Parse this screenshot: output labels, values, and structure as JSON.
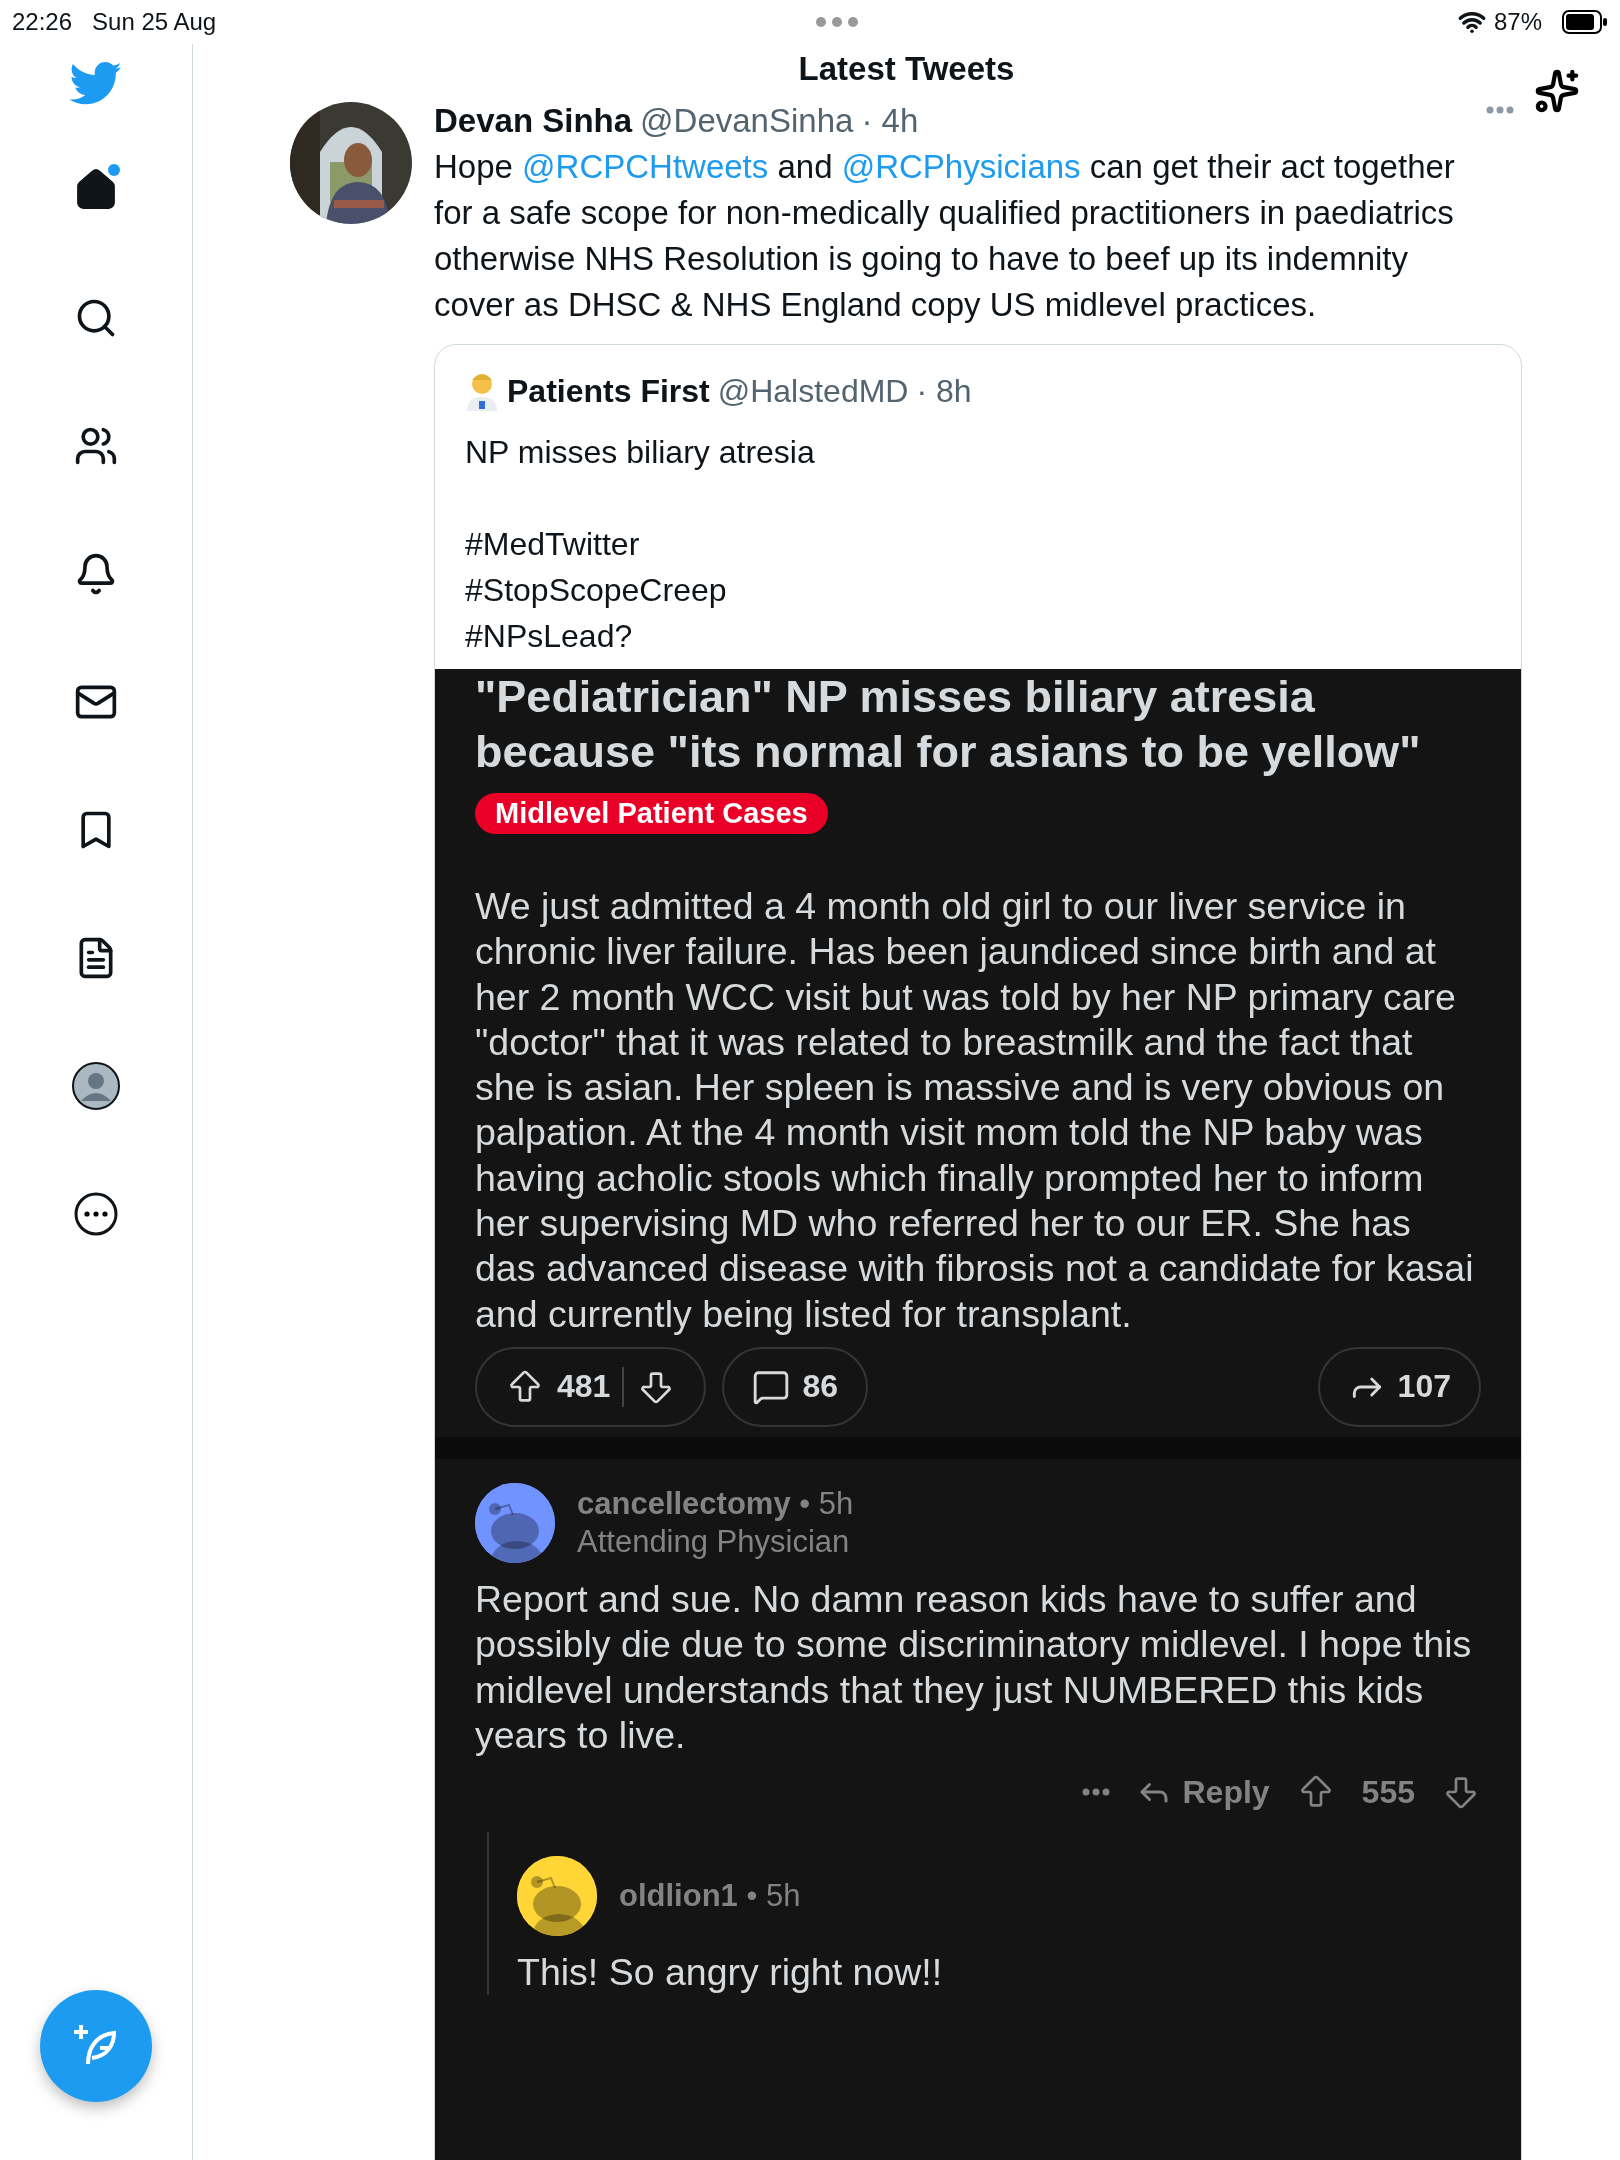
{
  "status_bar": {
    "time": "22:26",
    "date": "Sun 25 Aug",
    "battery": "87%"
  },
  "sidebar": {
    "items": [
      {
        "kind": "home",
        "selected": true,
        "unread": true
      },
      {
        "kind": "search",
        "selected": false,
        "unread": false
      },
      {
        "kind": "people",
        "selected": false,
        "unread": false
      },
      {
        "kind": "notifications",
        "selected": false,
        "unread": false
      },
      {
        "kind": "messages",
        "selected": false,
        "unread": false
      },
      {
        "kind": "bookmarks",
        "selected": false,
        "unread": false
      },
      {
        "kind": "lists",
        "selected": false,
        "unread": false
      },
      {
        "kind": "profile",
        "selected": false,
        "unread": false
      },
      {
        "kind": "more",
        "selected": false,
        "unread": false
      }
    ]
  },
  "header": {
    "title": "Latest Tweets"
  },
  "tweet": {
    "name": "Devan Sinha",
    "handle": "@DevanSinha",
    "time": "· 4h",
    "text": [
      {
        "kind": "text",
        "text": "Hope "
      },
      {
        "kind": "mention",
        "text": "@RCPCHtweets"
      },
      {
        "kind": "text",
        "text": " and "
      },
      {
        "kind": "mention",
        "text": "@RCPhysicians"
      },
      {
        "kind": "text",
        "text": " can get their act together for a safe scope for non-medically qualified practitioners in paediatrics otherwise NHS Resolution is going to have to beef up its indemnity cover as DHSC & NHS England copy US midlevel practices."
      }
    ],
    "quote": {
      "name": "Patients First",
      "handle": "@HalstedMD",
      "time": "· 8h",
      "text": "NP misses biliary atresia",
      "hashtags": [
        "#MedTwitter",
        "#StopScopeCreep",
        "#NPsLead?"
      ],
      "post": {
        "title": "\"Pediatrician\" NP misses biliary atresia because \"its normal for asians to be yellow\"",
        "flair": "Midlevel Patient Cases",
        "body": "We just admitted a 4 month old girl to our liver service in chronic liver failure. Has been jaundiced since birth and at her 2 month WCC visit but was told by her NP primary care \"doctor\" that it was related to breastmilk and the fact that she is asian. Her spleen is massive and is very obvious on palpation. At the 4 month visit mom told the NP baby was having acholic stools which finally prompted her to inform her supervising MD who referred her to our ER. She has  das advanced disease with fibrosis not a candidate for kasai and currently being listed for transplant.",
        "upvotes": "481",
        "comments": "86",
        "shares": "107",
        "replies": [
          {
            "user": "cancellectomy",
            "separator": "•",
            "time": "5h",
            "flair": "Attending Physician",
            "color": "#7193ff",
            "body": "Report and sue. No damn reason kids have to suffer and possibly die due to some discriminatory midlevel. I hope this midlevel understands that they just NUMBERED this kids years to live.",
            "reply_label": "Reply",
            "votes": "555",
            "children": [
              {
                "user": "oldlion1",
                "separator": "•",
                "time": "5h",
                "color": "#ffd635",
                "body": "This! So angry right now!!"
              }
            ]
          }
        ]
      }
    }
  }
}
